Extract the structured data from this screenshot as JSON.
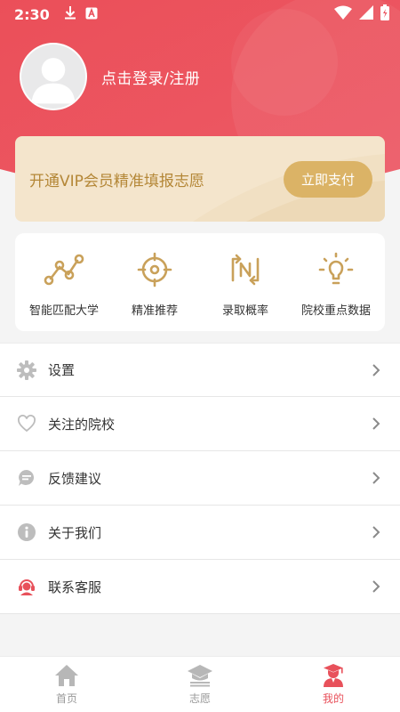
{
  "status_bar": {
    "time": "2:30"
  },
  "profile": {
    "login_label": "点击登录/注册"
  },
  "vip": {
    "text": "开通VIP会员精准填报志愿",
    "button": "立即支付"
  },
  "features": [
    {
      "label": "智能匹配大学",
      "icon": "graph-nodes-icon"
    },
    {
      "label": "精准推荐",
      "icon": "target-icon"
    },
    {
      "label": "录取概率",
      "icon": "probability-n-icon"
    },
    {
      "label": "院校重点数据",
      "icon": "lightbulb-icon"
    }
  ],
  "menu": [
    {
      "label": "设置",
      "icon": "gear-icon"
    },
    {
      "label": "关注的院校",
      "icon": "heart-icon"
    },
    {
      "label": "反馈建议",
      "icon": "chat-bubble-icon"
    },
    {
      "label": "关于我们",
      "icon": "info-icon"
    },
    {
      "label": "联系客服",
      "icon": "headset-icon"
    }
  ],
  "tabs": [
    {
      "label": "首页",
      "icon": "home-icon",
      "active": false
    },
    {
      "label": "志愿",
      "icon": "graduation-cap-book-icon",
      "active": false
    },
    {
      "label": "我的",
      "icon": "user-graduate-icon",
      "active": true
    }
  ],
  "colors": {
    "header_red": "#ea4e5a",
    "gold": "#dbb366",
    "active_tab": "#e8515b",
    "icon_gold": "#c9a15a",
    "menu_icon_gray": "#bdbdbd"
  }
}
